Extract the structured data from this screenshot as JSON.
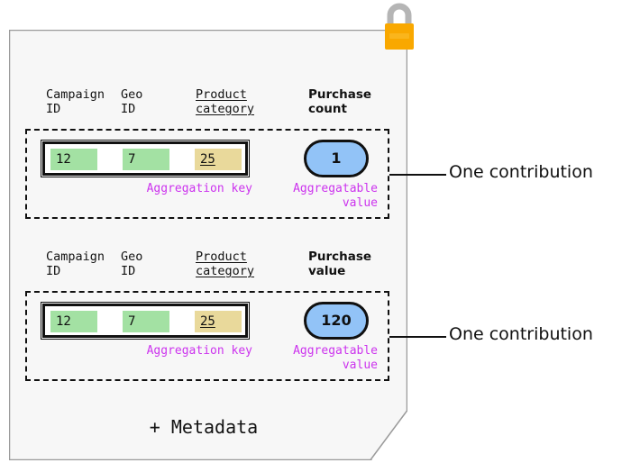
{
  "diagram": {
    "card": {
      "metadata_label": "+ Metadata",
      "lock_icon": "padlock-icon",
      "lock_body_color": "#f9a800",
      "lock_shackle_color": "#b5b5b5",
      "background_color": "#f7f7f7",
      "border_color": "#9a9a9a"
    },
    "colors": {
      "key_green": "#a3e1a3",
      "key_yellow": "#e9d99b",
      "value_blue": "#92c3f7",
      "caption_purple": "#cc33ee",
      "outline_black": "#101010"
    },
    "contributions": [
      {
        "headers": {
          "campaign_id": "Campaign\nID",
          "geo_id": "Geo\nID",
          "product_category": "Product\ncategory",
          "metric": "Purchase\ncount"
        },
        "aggregation_key": {
          "campaign_id": "12",
          "geo_id": "7",
          "product_category": "25"
        },
        "aggregatable_value": "1",
        "key_caption": "Aggregation key",
        "value_caption": "Aggregatable\nvalue",
        "callout_label": "One contribution"
      },
      {
        "headers": {
          "campaign_id": "Campaign\nID",
          "geo_id": "Geo\nID",
          "product_category": "Product\ncategory",
          "metric": "Purchase\nvalue"
        },
        "aggregation_key": {
          "campaign_id": "12",
          "geo_id": "7",
          "product_category": "25"
        },
        "aggregatable_value": "120",
        "key_caption": "Aggregation key",
        "value_caption": "Aggregatable\nvalue",
        "callout_label": "One contribution"
      }
    ]
  }
}
